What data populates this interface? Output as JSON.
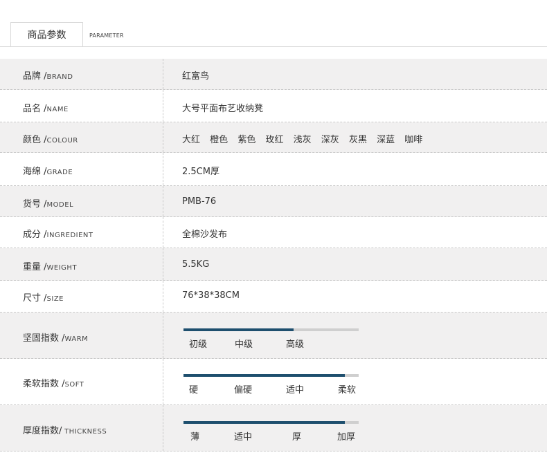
{
  "tab": {
    "title": "商品参数",
    "subtitle": "PARAMETER"
  },
  "rows": [
    {
      "label": "品牌 /",
      "en": "BRAND",
      "value": "红富鸟"
    },
    {
      "label": "品名 /",
      "en": "NAME",
      "value": "大号平面布艺收纳凳"
    },
    {
      "label": "颜色 /",
      "en": "COLOUR",
      "colors": [
        "大红",
        "橙色",
        "紫色",
        "玫红",
        "浅灰",
        "深灰",
        "灰黑",
        "深蓝",
        "咖啡"
      ]
    },
    {
      "label": "海绵 /",
      "en": "GRADE",
      "value": "2.5CM厚"
    },
    {
      "label": "货号 /",
      "en": "MODEL",
      "value": "PMB-76"
    },
    {
      "label": "成分 /",
      "en": "INGREDIENT",
      "value": "全棉沙发布"
    },
    {
      "label": "重量 /",
      "en": "WEIGHT",
      "value": "5.5KG"
    },
    {
      "label": "尺寸 /",
      "en": "SIZE",
      "value": "76*38*38CM"
    }
  ],
  "meters": [
    {
      "label": "坚固指数 /",
      "en": "WARM",
      "level": 0.63,
      "ticks": [
        "初级",
        "中级",
        "高级"
      ],
      "accent": "#1e4f6e"
    },
    {
      "label": "柔软指数 /",
      "en": "SOFT",
      "level": 0.92,
      "ticks": [
        "硬",
        "偏硬",
        "适中",
        "柔软"
      ],
      "accent": "#1e4f6e"
    },
    {
      "label": "厚度指数/",
      "en": " THICKNESS",
      "level": 0.92,
      "ticks": [
        "薄",
        "适中",
        "厚",
        "加厚"
      ],
      "accent": "#1e4f6e"
    }
  ]
}
